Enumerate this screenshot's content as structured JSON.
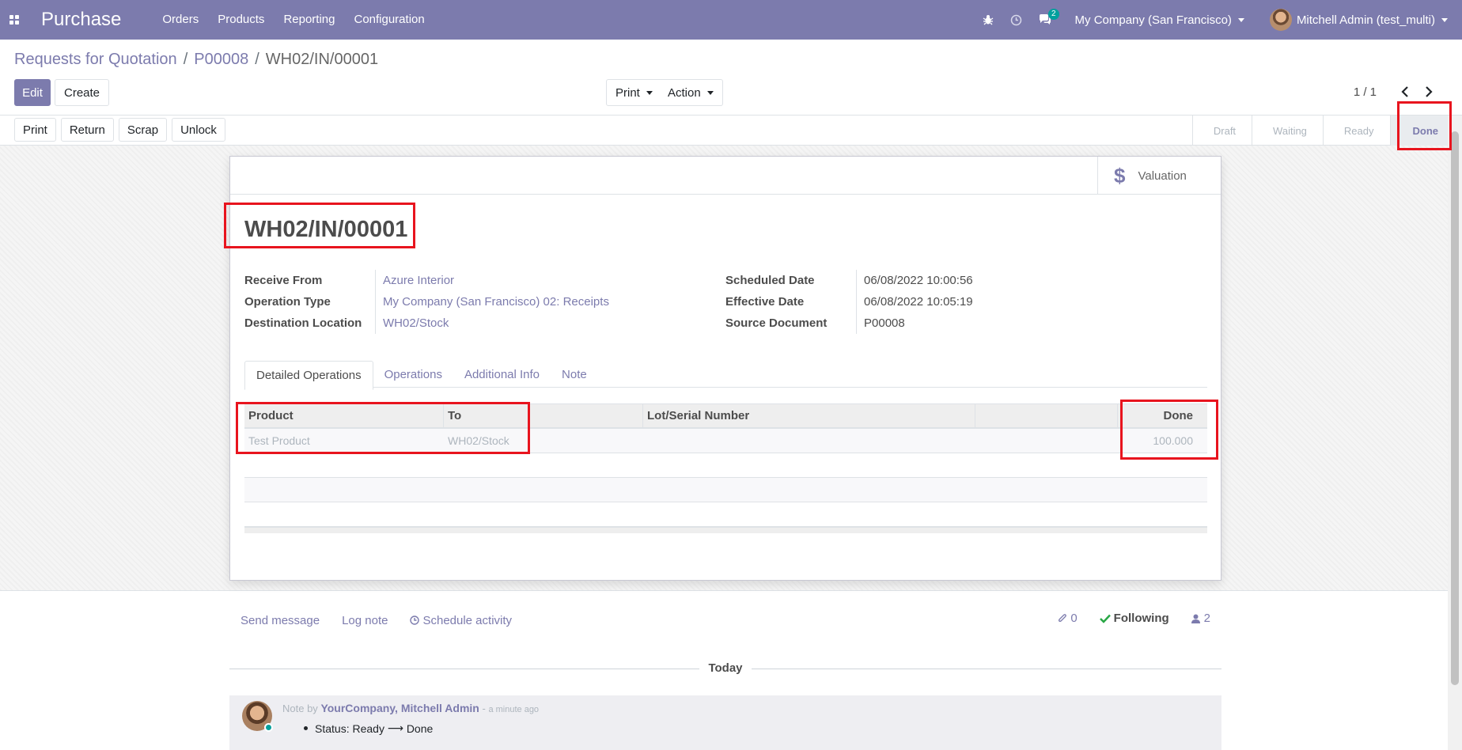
{
  "navbar": {
    "brand": "Purchase",
    "menu": [
      "Orders",
      "Products",
      "Reporting",
      "Configuration"
    ],
    "chat_badge": "2",
    "company": "My Company (San Francisco)",
    "user": "Mitchell Admin (test_multi)"
  },
  "breadcrumb": {
    "items": [
      "Requests for Quotation",
      "P00008"
    ],
    "current": "WH02/IN/00001",
    "separator": "/"
  },
  "control": {
    "edit_label": "Edit",
    "create_label": "Create",
    "print_label": "Print",
    "action_label": "Action",
    "pager": "1 / 1"
  },
  "statusbar": {
    "buttons": [
      "Print",
      "Return",
      "Scrap",
      "Unlock"
    ],
    "steps": [
      "Draft",
      "Waiting",
      "Ready",
      "Done"
    ],
    "current_step": "Done"
  },
  "sheet": {
    "valuation_label": "Valuation",
    "title": "WH02/IN/00001",
    "left_fields": [
      {
        "label": "Receive From",
        "value": "Azure Interior"
      },
      {
        "label": "Operation Type",
        "value": "My Company (San Francisco) 02: Receipts"
      },
      {
        "label": "Destination Location",
        "value": "WH02/Stock"
      }
    ],
    "right_fields": [
      {
        "label": "Scheduled Date",
        "value": "06/08/2022 10:00:56"
      },
      {
        "label": "Effective Date",
        "value": "06/08/2022 10:05:19"
      },
      {
        "label": "Source Document",
        "value": "P00008"
      }
    ],
    "tabs": [
      "Detailed Operations",
      "Operations",
      "Additional Info",
      "Note"
    ],
    "active_tab": "Detailed Operations",
    "table": {
      "headers": {
        "product": "Product",
        "to": "To",
        "lot": "Lot/Serial Number",
        "done": "Done"
      },
      "rows": [
        {
          "product": "Test Product",
          "to": "WH02/Stock",
          "lot": "",
          "done": "100.000"
        }
      ]
    }
  },
  "chatter": {
    "send_message": "Send message",
    "log_note": "Log note",
    "schedule_activity": "Schedule activity",
    "attachments": "0",
    "following": "Following",
    "followers": "2",
    "date_separator": "Today",
    "message": {
      "prefix": "Note by",
      "author": "YourCompany, Mitchell Admin",
      "dash": "-",
      "ago": "a minute ago",
      "status_label": "Status:",
      "from": "Ready",
      "arrow": "⟶",
      "to": "Done"
    }
  },
  "colors": {
    "brand": "#7c7bad",
    "highlight": "#e8141e",
    "teal": "#00a09d"
  }
}
